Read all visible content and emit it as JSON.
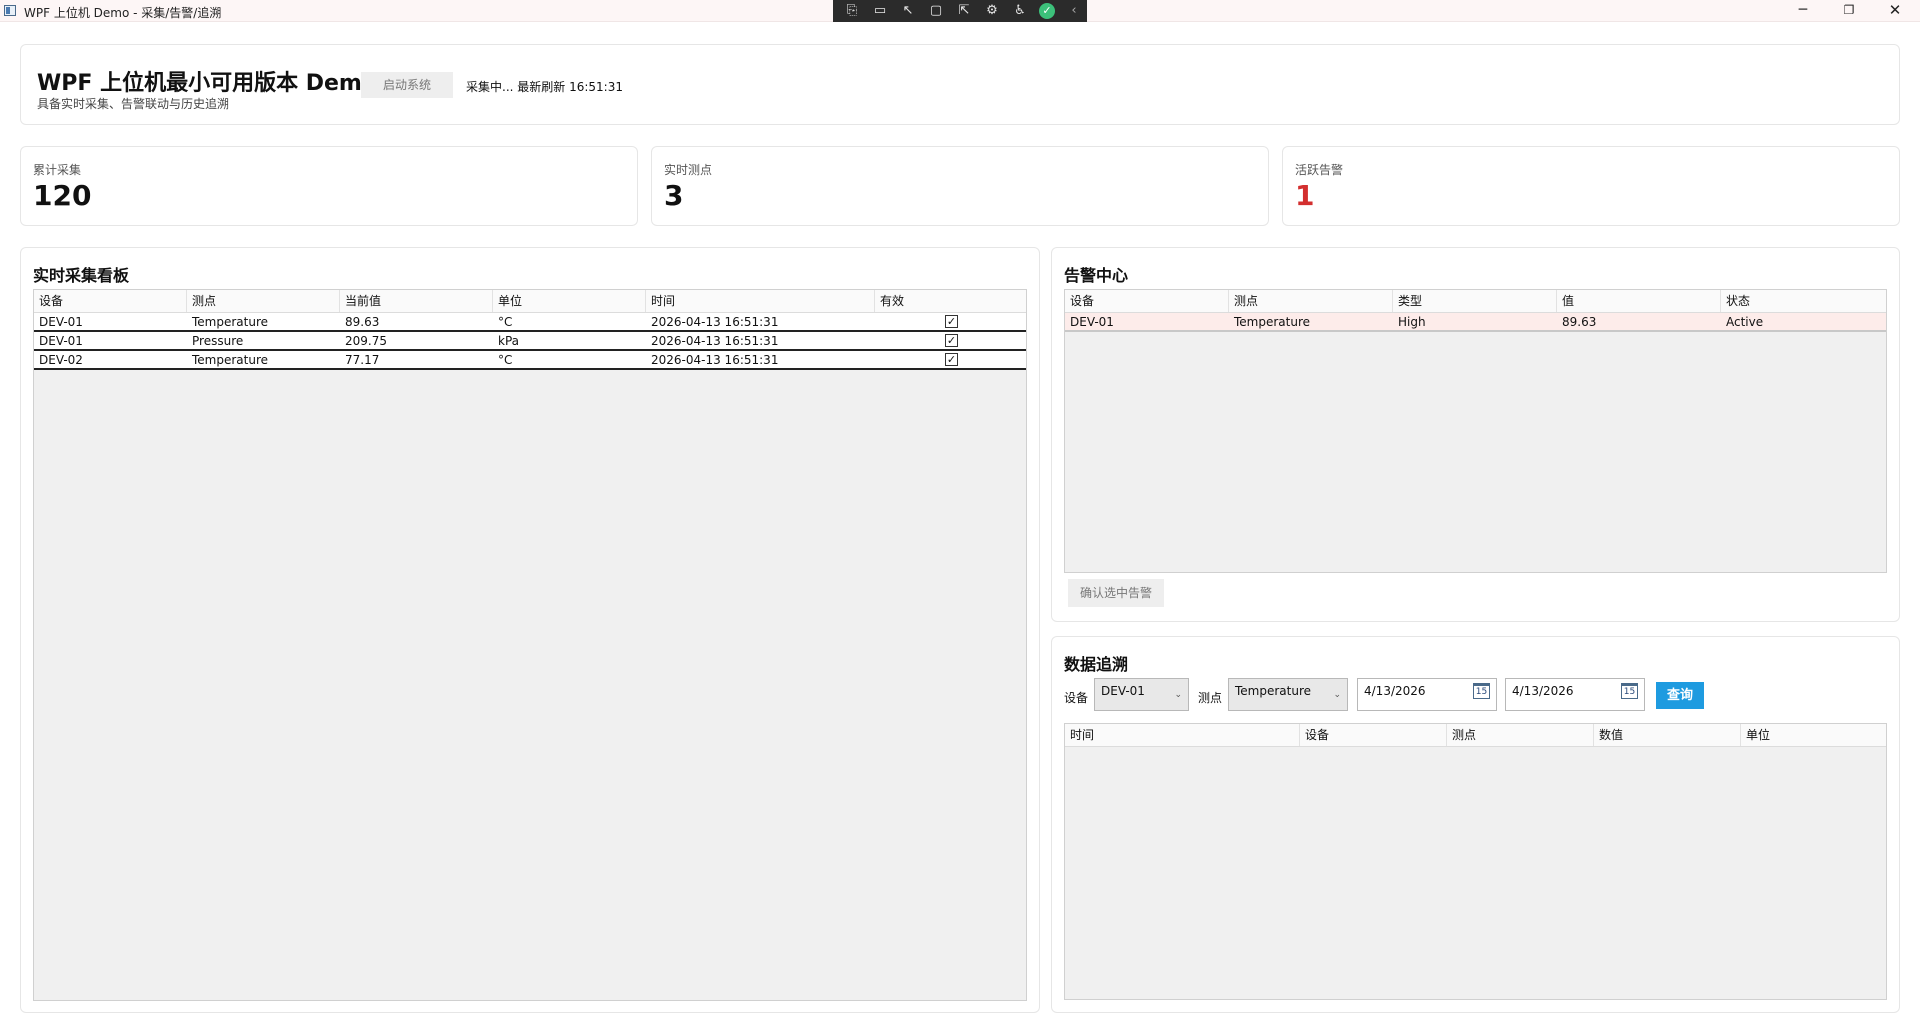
{
  "window": {
    "title": "WPF 上位机 Demo - 采集/告警/追溯",
    "devtools": [
      "⎘",
      "▭",
      "↖",
      "▢",
      "⇱",
      "⚙",
      "♿",
      "✓",
      "‹"
    ],
    "controls": {
      "minimize": "─",
      "maximize": "❐",
      "close": "✕"
    }
  },
  "header": {
    "title": "WPF 上位机最小可用版本 Demo",
    "subtitle": "具备实时采集、告警联动与历史追溯",
    "start_button": "启动系统",
    "status": "采集中... 最新刷新 16:51:31"
  },
  "stats": [
    {
      "label": "累计采集",
      "value": "120"
    },
    {
      "label": "实时测点",
      "value": "3"
    },
    {
      "label": "活跃告警",
      "value": "1",
      "color": "#d32f2f"
    }
  ],
  "realtime": {
    "title": "实时采集看板",
    "columns": [
      "设备",
      "测点",
      "当前值",
      "单位",
      "时间",
      "有效"
    ],
    "rows": [
      {
        "device": "DEV-01",
        "point": "Temperature",
        "value": "89.63",
        "unit": "°C",
        "time": "2026-04-13 16:51:31",
        "valid": true
      },
      {
        "device": "DEV-01",
        "point": "Pressure",
        "value": "209.75",
        "unit": "kPa",
        "time": "2026-04-13 16:51:31",
        "valid": true
      },
      {
        "device": "DEV-02",
        "point": "Temperature",
        "value": "77.17",
        "unit": "°C",
        "time": "2026-04-13 16:51:31",
        "valid": true
      }
    ]
  },
  "alarms": {
    "title": "告警中心",
    "columns": [
      "设备",
      "测点",
      "类型",
      "值",
      "状态"
    ],
    "rows": [
      {
        "device": "DEV-01",
        "point": "Temperature",
        "type": "High",
        "value": "89.63",
        "status": "Active"
      }
    ],
    "ack_button": "确认选中告警",
    "row_color": "#fdecea"
  },
  "trace": {
    "title": "数据追溯",
    "device_label": "设备",
    "device_value": "DEV-01",
    "point_label": "测点",
    "point_value": "Temperature",
    "date_from": "4/13/2026",
    "date_to": "4/13/2026",
    "calendar_glyph": "15",
    "query_button": "查询",
    "query_color": "#1e9be0",
    "columns": [
      "时间",
      "设备",
      "测点",
      "数值",
      "单位"
    ]
  }
}
